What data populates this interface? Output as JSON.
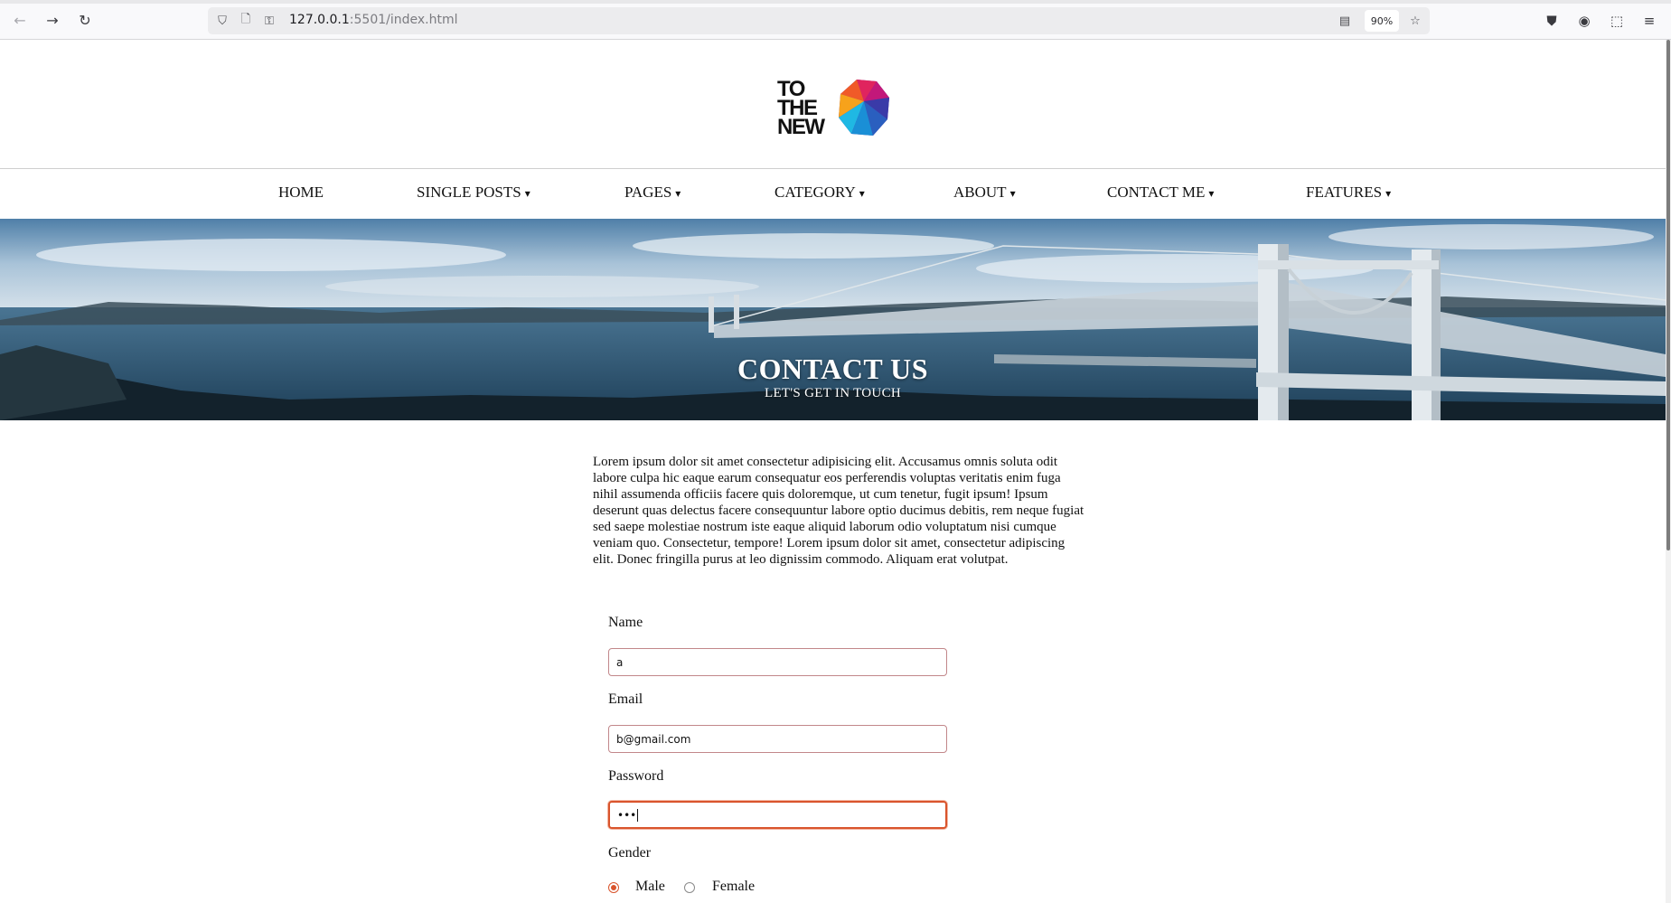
{
  "browser": {
    "url_host": "127.0.0.1",
    "url_path": ":5501/index.html",
    "zoom": "90%"
  },
  "site": {
    "logo_lines": [
      "TO",
      "THE",
      "NEW"
    ]
  },
  "nav": {
    "items": [
      {
        "label": "HOME",
        "has_dropdown": false
      },
      {
        "label": "SINGLE POSTS",
        "has_dropdown": true
      },
      {
        "label": "PAGES",
        "has_dropdown": true
      },
      {
        "label": "CATEGORY",
        "has_dropdown": true
      },
      {
        "label": "ABOUT",
        "has_dropdown": true
      },
      {
        "label": "CONTACT ME",
        "has_dropdown": true
      },
      {
        "label": "FEATURES",
        "has_dropdown": true
      }
    ],
    "caret": "▾"
  },
  "hero": {
    "title": "CONTACT US",
    "subtitle": "LET'S GET IN TOUCH"
  },
  "intro": {
    "text": "Lorem ipsum dolor sit amet consectetur adipisicing elit. Accusamus omnis soluta odit labore culpa hic eaque earum consequatur eos perferendis voluptas veritatis enim fuga nihil assumenda officiis facere quis doloremque, ut cum tenetur, fugit ipsum! Ipsum deserunt quas delectus facere consequuntur labore optio ducimus debitis, rem neque fugiat sed saepe molestiae nostrum iste eaque aliquid laborum odio voluptatum nisi cumque veniam quo. Consectetur, tempore! Lorem ipsum dolor sit amet, consectetur adipiscing elit. Donec fringilla purus at leo dignissim commodo. Aliquam erat volutpat."
  },
  "form": {
    "name_label": "Name",
    "name_value": "a",
    "email_label": "Email",
    "email_value": "b@gmail.com",
    "password_label": "Password",
    "password_value": "•••",
    "gender_label": "Gender",
    "gender_options": [
      "Male",
      "Female"
    ],
    "gender_selected": "Male"
  },
  "colors": {
    "accent": "#d9542c",
    "field_border": "#c2878a"
  }
}
